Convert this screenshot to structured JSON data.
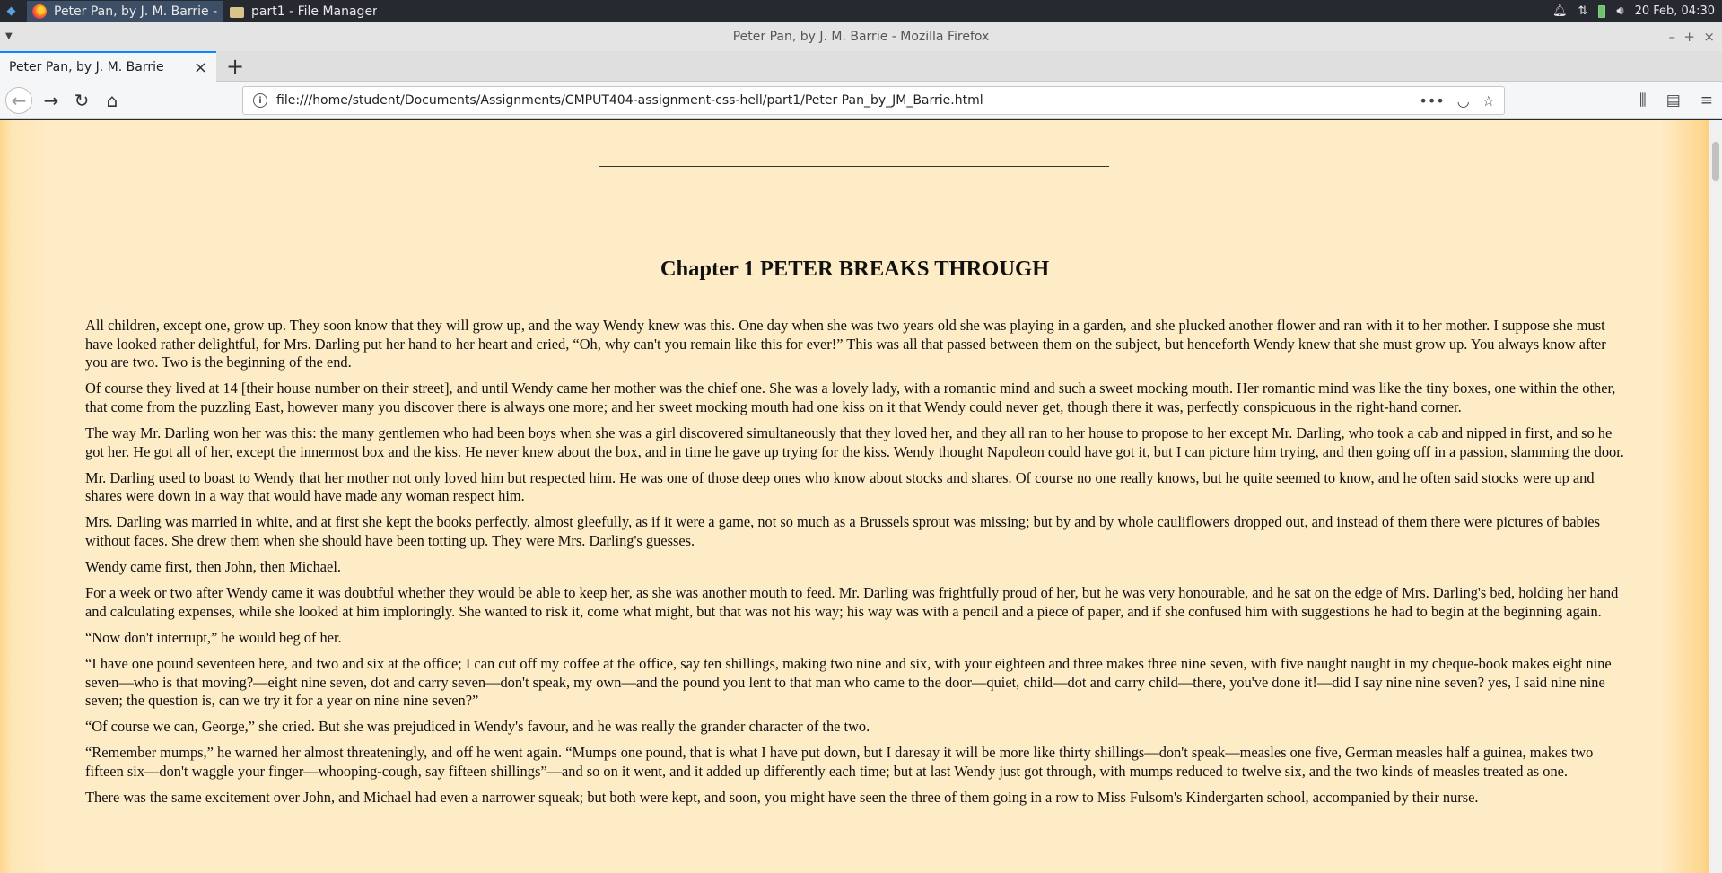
{
  "taskbar": {
    "tasks": [
      {
        "label": "Peter Pan, by J. M. Barrie - M..."
      },
      {
        "label": "part1 - File Manager"
      }
    ],
    "clock": "20 Feb, 04:30"
  },
  "window": {
    "title": "Peter Pan, by J. M. Barrie - Mozilla Firefox"
  },
  "tabs": [
    {
      "label": "Peter Pan, by J. M. Barrie"
    }
  ],
  "navbar": {
    "url": "file:///home/student/Documents/Assignments/CMPUT404-assignment-css-hell/part1/Peter Pan_by_JM_Barrie.html"
  },
  "content": {
    "chapter_title": "Chapter 1 PETER BREAKS THROUGH",
    "paragraphs": [
      "All children, except one, grow up. They soon know that they will grow up, and the way Wendy knew was this. One day when she was two years old she was playing in a garden, and she plucked another flower and ran with it to her mother. I suppose she must have looked rather delightful, for Mrs. Darling put her hand to her heart and cried, “Oh, why can't you remain like this for ever!” This was all that passed between them on the subject, but henceforth Wendy knew that she must grow up. You always know after you are two. Two is the beginning of the end.",
      "Of course they lived at 14 [their house number on their street], and until Wendy came her mother was the chief one. She was a lovely lady, with a romantic mind and such a sweet mocking mouth. Her romantic mind was like the tiny boxes, one within the other, that come from the puzzling East, however many you discover there is always one more; and her sweet mocking mouth had one kiss on it that Wendy could never get, though there it was, perfectly conspicuous in the right-hand corner.",
      "The way Mr. Darling won her was this: the many gentlemen who had been boys when she was a girl discovered simultaneously that they loved her, and they all ran to her house to propose to her except Mr. Darling, who took a cab and nipped in first, and so he got her. He got all of her, except the innermost box and the kiss. He never knew about the box, and in time he gave up trying for the kiss. Wendy thought Napoleon could have got it, but I can picture him trying, and then going off in a passion, slamming the door.",
      "Mr. Darling used to boast to Wendy that her mother not only loved him but respected him. He was one of those deep ones who know about stocks and shares. Of course no one really knows, but he quite seemed to know, and he often said stocks were up and shares were down in a way that would have made any woman respect him.",
      "Mrs. Darling was married in white, and at first she kept the books perfectly, almost gleefully, as if it were a game, not so much as a Brussels sprout was missing; but by and by whole cauliflowers dropped out, and instead of them there were pictures of babies without faces. She drew them when she should have been totting up. They were Mrs. Darling's guesses.",
      "Wendy came first, then John, then Michael.",
      "For a week or two after Wendy came it was doubtful whether they would be able to keep her, as she was another mouth to feed. Mr. Darling was frightfully proud of her, but he was very honourable, and he sat on the edge of Mrs. Darling's bed, holding her hand and calculating expenses, while she looked at him imploringly. She wanted to risk it, come what might, but that was not his way; his way was with a pencil and a piece of paper, and if she confused him with suggestions he had to begin at the beginning again.",
      "“Now don't interrupt,” he would beg of her.",
      "“I have one pound seventeen here, and two and six at the office; I can cut off my coffee at the office, say ten shillings, making two nine and six, with your eighteen and three makes three nine seven, with five naught naught in my cheque-book makes eight nine seven—who is that moving?—eight nine seven, dot and carry seven—don't speak, my own—and the pound you lent to that man who came to the door—quiet, child—dot and carry child—there, you've done it!—did I say nine nine seven? yes, I said nine nine seven; the question is, can we try it for a year on nine nine seven?”",
      "“Of course we can, George,” she cried. But she was prejudiced in Wendy's favour, and he was really the grander character of the two.",
      "“Remember mumps,” he warned her almost threateningly, and off he went again. “Mumps one pound, that is what I have put down, but I daresay it will be more like thirty shillings—don't speak—measles one five, German measles half a guinea, makes two fifteen six—don't waggle your finger—whooping-cough, say fifteen shillings”—and so on it went, and it added up differently each time; but at last Wendy just got through, with mumps reduced to twelve six, and the two kinds of measles treated as one.",
      "There was the same excitement over John, and Michael had even a narrower squeak; but both were kept, and soon, you might have seen the three of them going in a row to Miss Fulsom's Kindergarten school, accompanied by their nurse."
    ]
  }
}
